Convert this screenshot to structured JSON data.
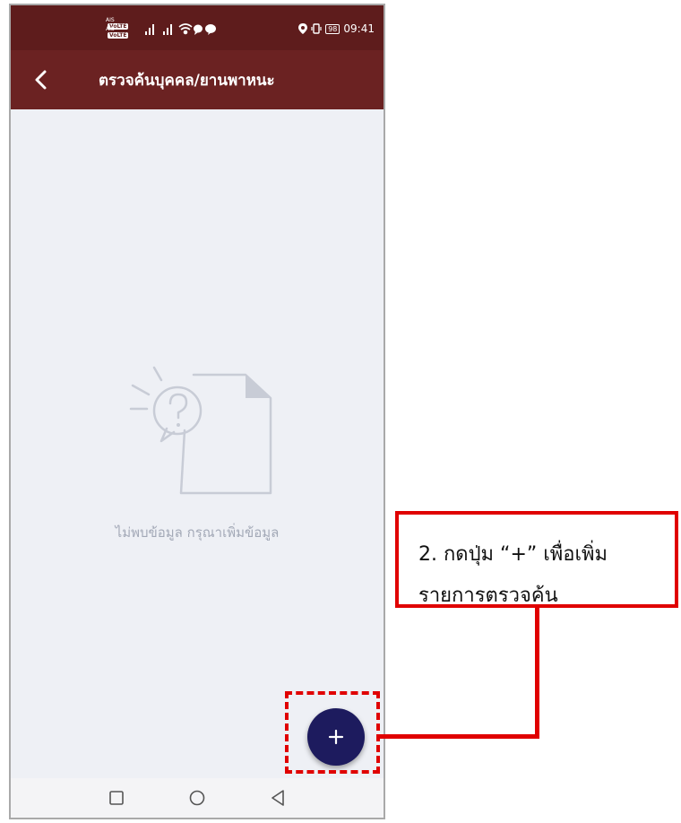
{
  "status_bar": {
    "carrier_top": "AIS",
    "carrier_bottom": "AIS",
    "volte_badge": "VoLTE",
    "battery": "98",
    "time": "09:41",
    "icons": [
      "signal-icon",
      "signal-icon",
      "wifi-icon",
      "chat-icon",
      "line-icon",
      "location-icon",
      "vibrate-icon",
      "battery-icon"
    ]
  },
  "app_bar": {
    "title": "ตรวจค้นบุคคล/ยานพาหนะ",
    "back_icon": "chevron-left-icon",
    "color": "#6b2222"
  },
  "content": {
    "empty_message": "ไม่พบข้อมูล กรุณาเพิ่มข้อมูล",
    "illustration": "document-question-icon"
  },
  "fab": {
    "label": "+",
    "color": "#1d1b5e"
  },
  "nav_bar": {
    "items": [
      "recent-apps-icon",
      "home-icon",
      "back-triangle-icon"
    ]
  },
  "annotation": {
    "line1": "2. กดปุ่ม “+” เพื่อเพิ่ม",
    "line2": "รายการตรวจค้น",
    "color": "#e00000"
  }
}
